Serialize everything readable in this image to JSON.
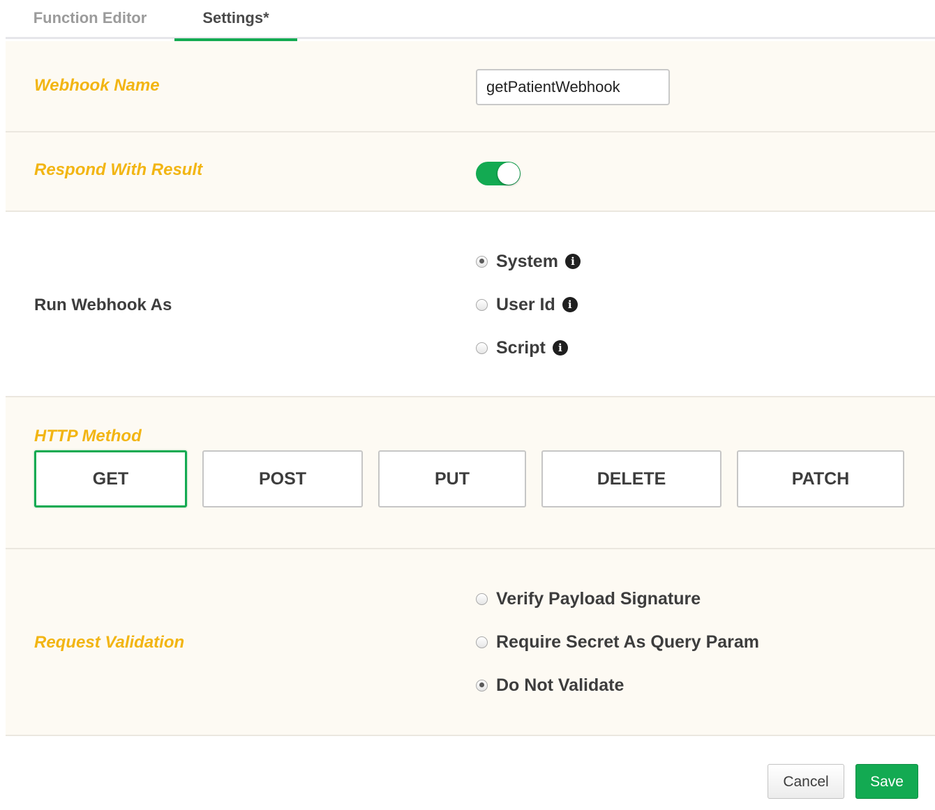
{
  "tabs": [
    {
      "label": "Function Editor",
      "active": false
    },
    {
      "label": "Settings*",
      "active": true
    }
  ],
  "webhook_name": {
    "label": "Webhook Name",
    "value": "getPatientWebhook"
  },
  "respond_with_result": {
    "label": "Respond With Result",
    "enabled": true
  },
  "run_webhook_as": {
    "label": "Run Webhook As",
    "options": [
      {
        "label": "System",
        "selected": true,
        "icon": "info-icon"
      },
      {
        "label": "User Id",
        "selected": false,
        "icon": "info-icon"
      },
      {
        "label": "Script",
        "selected": false,
        "icon": "info-icon"
      }
    ]
  },
  "http_method": {
    "label": "HTTP Method",
    "methods": [
      "GET",
      "POST",
      "PUT",
      "DELETE",
      "PATCH"
    ],
    "selected": "GET"
  },
  "request_validation": {
    "label": "Request Validation",
    "options": [
      {
        "label": "Verify Payload Signature",
        "selected": false
      },
      {
        "label": "Require Secret As Query Param",
        "selected": false
      },
      {
        "label": "Do Not Validate",
        "selected": true
      }
    ]
  },
  "footer": {
    "cancel_label": "Cancel",
    "save_label": "Save"
  },
  "colors": {
    "accent": "#13aa52",
    "required_label": "#f2b513",
    "section_bg": "#fdfaf3"
  }
}
